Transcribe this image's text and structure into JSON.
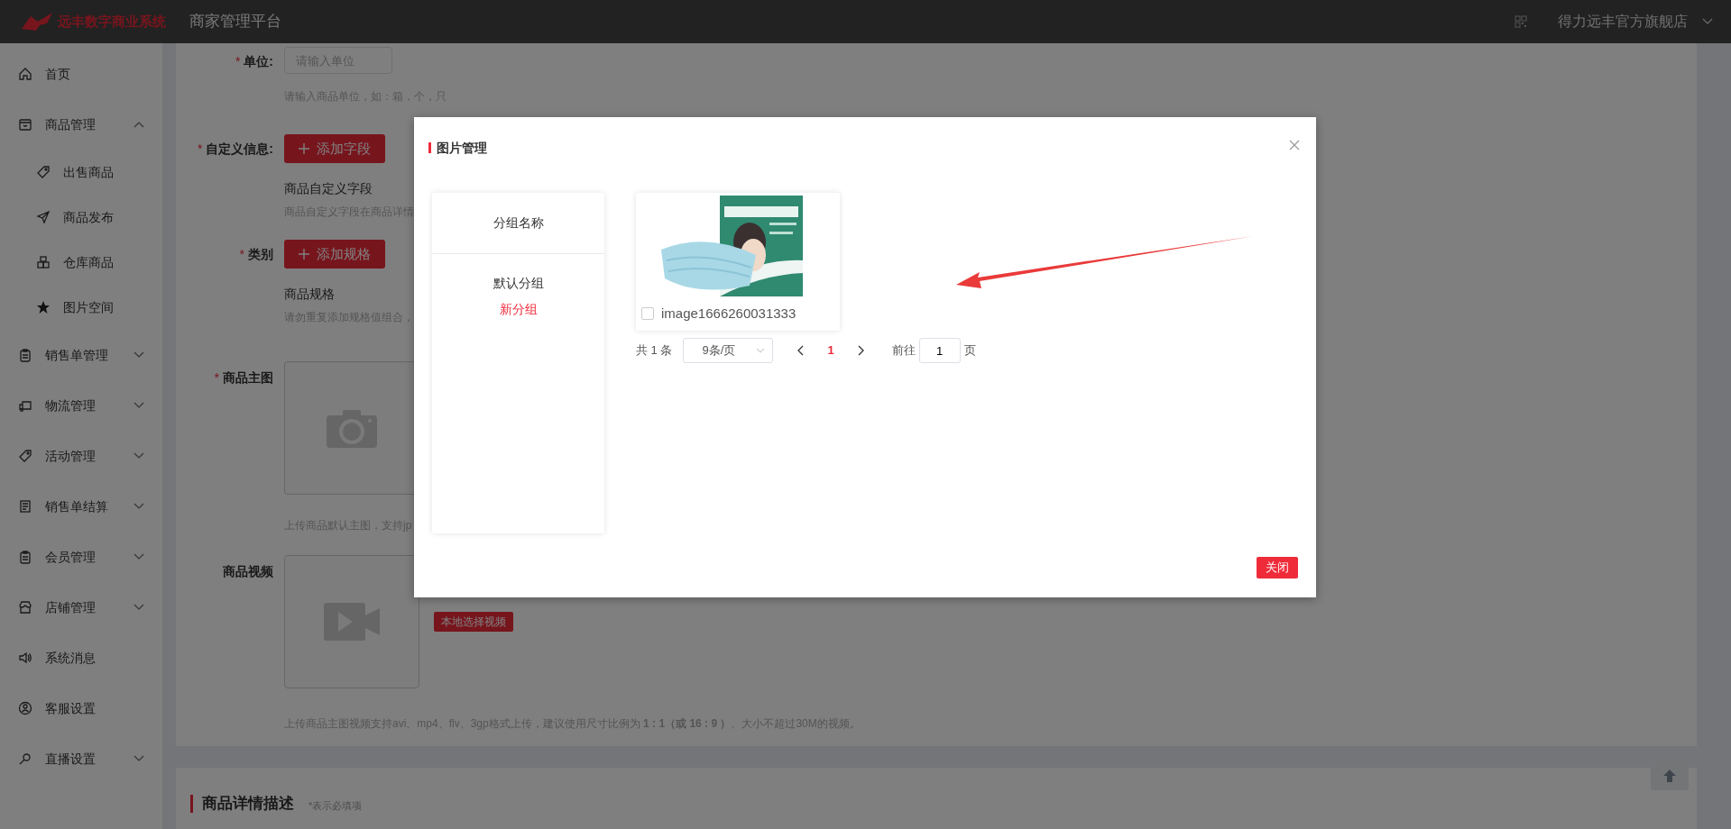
{
  "header": {
    "logo_text": "远丰数字商业系统",
    "title": "商家管理平台",
    "store_name": "得力远丰官方旗舰店"
  },
  "sidebar": {
    "items": [
      {
        "label": "首页"
      },
      {
        "label": "商品管理",
        "expanded": true,
        "children": [
          {
            "label": "出售商品"
          },
          {
            "label": "商品发布"
          },
          {
            "label": "仓库商品"
          },
          {
            "label": "图片空间"
          }
        ]
      },
      {
        "label": "销售单管理",
        "expanded": false
      },
      {
        "label": "物流管理",
        "expanded": false
      },
      {
        "label": "活动管理",
        "expanded": false
      },
      {
        "label": "销售单结算",
        "expanded": false
      },
      {
        "label": "会员管理",
        "expanded": false
      },
      {
        "label": "店铺管理",
        "expanded": false
      },
      {
        "label": "系统消息"
      },
      {
        "label": "客服设置"
      },
      {
        "label": "直播设置",
        "expanded": false
      }
    ]
  },
  "form": {
    "rows": [
      {
        "kind": "input",
        "required_mark": "*",
        "label": "单位:",
        "placeholder": "请输入单位",
        "hint": "请输入商品单位，如：箱，个，只"
      },
      {
        "kind": "button",
        "required_mark": "*",
        "label": "自定义信息:",
        "button": "添加字段",
        "note": "商品自定义字段",
        "hint": "商品自定义字段在商品详情"
      },
      {
        "kind": "button",
        "required_mark": "*",
        "label": "类别",
        "button": "添加规格",
        "note": "商品规格",
        "hint": "请勿重复添加规格值组合，"
      },
      {
        "required_mark": "*",
        "label": "商品主图",
        "hint": "上传商品默认主图，支持jp"
      },
      {
        "kind": "video",
        "label": "商品视频",
        "button": "本地选择视频",
        "hint": "上传商品主图视频支持avi、mp4、flv、3gp格式上传，建议使用尺寸比例为 **1 : 1（或 16 : 9 ）**、大小不超过30M的视频。"
      }
    ]
  },
  "detail_section": {
    "title": "商品详情描述",
    "note": "*表示必填项"
  },
  "dialog": {
    "title": "图片管理",
    "groups_header": "分组名称",
    "groups": [
      {
        "kind": "group",
        "label": "默认分组"
      },
      {
        "kind": "add",
        "label": "新分组"
      }
    ],
    "images": [
      {
        "name": "image1666260031333",
        "checked": false
      }
    ],
    "pagination": {
      "total": "共 1 条",
      "page_size": "9条/页",
      "pages": [
        {
          "label": "1",
          "selected": true
        }
      ],
      "goto_label": "前往",
      "goto_value": "1",
      "goto_suffix": "页"
    },
    "close_button": "关闭"
  }
}
